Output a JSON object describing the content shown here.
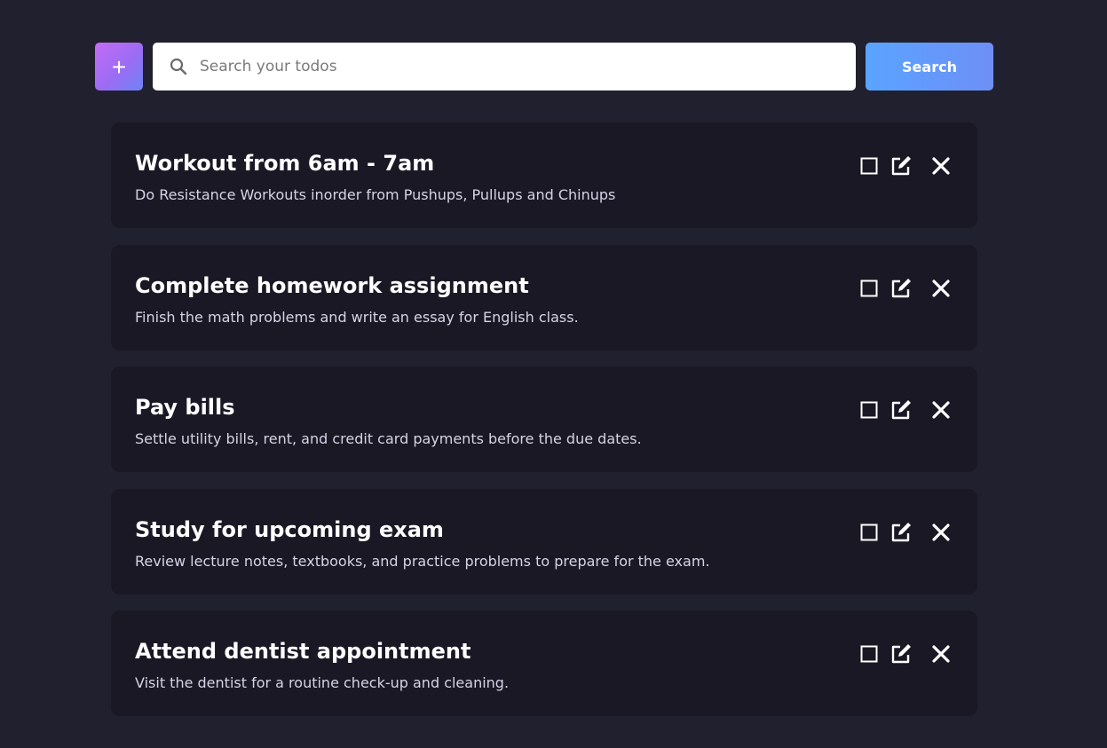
{
  "toolbar": {
    "add_label": "+",
    "search_placeholder": "Search your todos",
    "search_value": "",
    "search_label": "Search"
  },
  "todos": [
    {
      "title": "Workout from 6am - 7am",
      "description": "Do Resistance Workouts inorder from Pushups, Pullups and Chinups"
    },
    {
      "title": "Complete homework assignment",
      "description": "Finish the math problems and write an essay for English class."
    },
    {
      "title": "Pay bills",
      "description": "Settle utility bills, rent, and credit card payments before the due dates."
    },
    {
      "title": "Study for upcoming exam",
      "description": "Review lecture notes, textbooks, and practice problems to prepare for the exam."
    },
    {
      "title": "Attend dentist appointment",
      "description": "Visit the dentist for a routine check-up and cleaning."
    }
  ],
  "icons": {
    "search": "search-icon",
    "checkbox": "checkbox-icon",
    "edit": "edit-icon",
    "delete": "close-icon"
  },
  "colors": {
    "background": "#21202e",
    "card": "#1a1825",
    "add_gradient_start": "#c46cf5",
    "add_gradient_end": "#6e84f7",
    "search_button_start": "#59a4ff",
    "search_button_end": "#6e8ff6"
  }
}
